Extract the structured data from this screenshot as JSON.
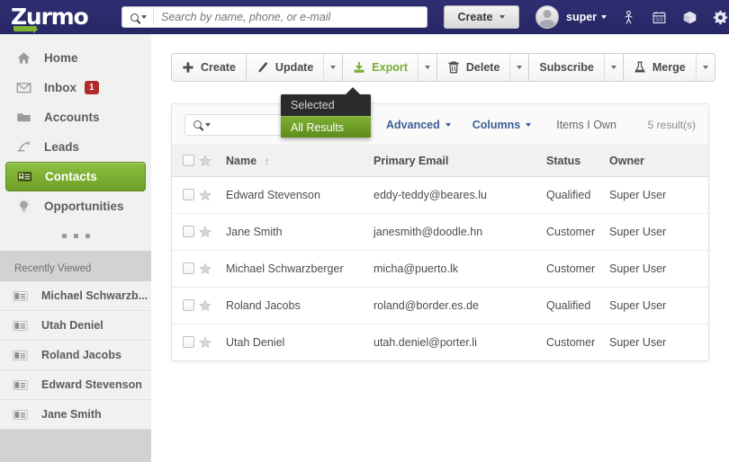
{
  "header": {
    "logo_text": "Zurmo",
    "search_placeholder": "Search by name, phone, or e-mail",
    "search_value": "",
    "create_label": "Create",
    "username": "super",
    "icons": [
      "mascot-icon",
      "calendar-icon",
      "gamification-cube-icon",
      "gear-icon"
    ]
  },
  "sidebar": {
    "items": [
      {
        "label": "Home",
        "icon": "home-icon",
        "active": false,
        "badge": ""
      },
      {
        "label": "Inbox",
        "icon": "envelope-icon",
        "active": false,
        "badge": "1"
      },
      {
        "label": "Accounts",
        "icon": "folder-icon",
        "active": false,
        "badge": ""
      },
      {
        "label": "Leads",
        "icon": "leads-icon",
        "active": false,
        "badge": ""
      },
      {
        "label": "Contacts",
        "icon": "contact-card-icon",
        "active": true,
        "badge": ""
      },
      {
        "label": "Opportunities",
        "icon": "lightbulb-icon",
        "active": false,
        "badge": ""
      }
    ],
    "more_label": "...",
    "recently_viewed_title": "Recently Viewed",
    "recently_viewed": [
      {
        "label": "Michael Schwarzb...",
        "icon": "contact-card-icon"
      },
      {
        "label": "Utah Deniel",
        "icon": "contact-card-icon"
      },
      {
        "label": "Roland Jacobs",
        "icon": "contact-card-icon"
      },
      {
        "label": "Edward Stevenson",
        "icon": "contact-card-icon"
      },
      {
        "label": "Jane Smith",
        "icon": "contact-card-icon"
      }
    ]
  },
  "toolbar": {
    "buttons": [
      {
        "label": "Create",
        "icon": "plus-icon",
        "has_arrow": false,
        "green": false
      },
      {
        "label": "Update",
        "icon": "pencil-icon",
        "has_arrow": true,
        "green": false
      },
      {
        "label": "Export",
        "icon": "export-icon",
        "has_arrow": true,
        "green": true
      },
      {
        "label": "Delete",
        "icon": "trash-icon",
        "has_arrow": true,
        "green": false
      },
      {
        "label": "Subscribe",
        "icon": "",
        "has_arrow": true,
        "green": false
      },
      {
        "label": "Merge",
        "icon": "flask-icon",
        "has_arrow": true,
        "green": false
      }
    ]
  },
  "export_menu": {
    "open": true,
    "items": [
      {
        "label": "Selected",
        "selected": false
      },
      {
        "label": "All Results",
        "selected": true
      }
    ],
    "highlight_color": "#6d9d25"
  },
  "filter_bar": {
    "search_value": "",
    "search_placeholder": "",
    "advanced_label": "Advanced",
    "columns_label": "Columns",
    "items_own_label": "Items I Own",
    "result_count": "5 result(s)"
  },
  "table": {
    "columns": [
      "Name",
      "Primary Email",
      "Status",
      "Owner"
    ],
    "sort_column": "Name",
    "sort_direction": "asc",
    "sort_glyph": "↑",
    "rows": [
      {
        "name": "Edward Stevenson",
        "email": "eddy-teddy@beares.lu",
        "status": "Qualified",
        "owner": "Super User"
      },
      {
        "name": "Jane Smith",
        "email": "janesmith@doodle.hn",
        "status": "Customer",
        "owner": "Super User"
      },
      {
        "name": "Michael Schwarzberger",
        "email": "micha@puerto.lk",
        "status": "Customer",
        "owner": "Super User"
      },
      {
        "name": "Roland Jacobs",
        "email": "roland@border.es.de",
        "status": "Qualified",
        "owner": "Super User"
      },
      {
        "name": "Utah Deniel",
        "email": "utah.deniel@porter.li",
        "status": "Customer",
        "owner": "Super User"
      }
    ]
  },
  "colors": {
    "header_bg": "#2e2e72",
    "accent_green": "#7db72f",
    "badge_red": "#b02a2a",
    "link_blue": "#3a5f93"
  }
}
